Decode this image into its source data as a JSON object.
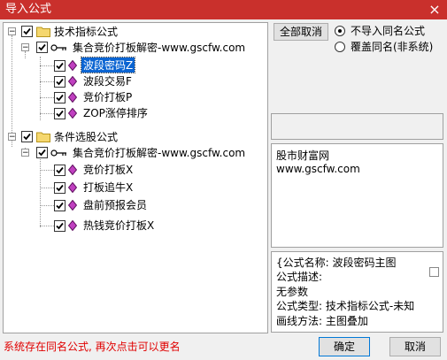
{
  "window": {
    "title": "导入公式",
    "close_glyph": "×"
  },
  "tree": {
    "groups": [
      {
        "label": "技术指标公式",
        "checked": true,
        "children": [
          {
            "label": "集合竞价打板解密-www.gscfw.com",
            "items": [
              "波段密码Z",
              "波段交易F",
              "竞价打板P",
              "ZOP涨停排序"
            ]
          }
        ]
      },
      {
        "label": "条件选股公式",
        "checked": true,
        "children": [
          {
            "label": "集合竞价打板解密-www.gscfw.com",
            "items": [
              "竞价打板X",
              "打板追牛X",
              "盘前预报会员",
              "热钱竞价打板X"
            ]
          }
        ]
      }
    ],
    "selected_item": "波段密码Z"
  },
  "controls": {
    "cancel_all_label": "全部取消",
    "radio_no_import": "不导入同名公式",
    "radio_overwrite": "覆盖同名(非系统)"
  },
  "info_panel": {
    "line1": "股市财富网",
    "line2": "www.gscfw.com"
  },
  "detail_panel": {
    "line1": "{公式名称: 波段密码主图",
    "line2": "公式描述:",
    "line3": "无参数",
    "line4": "公式类型: 技术指标公式-未知",
    "line5": "画线方法: 主图叠加"
  },
  "footer": {
    "status_text": "系统存在同名公式, 再次点击可以更名",
    "ok_label": "确定",
    "cancel_label": "取消"
  },
  "colors": {
    "title_bar": "#c9302c",
    "selection": "#0a64d2",
    "status_text": "#e00000"
  }
}
